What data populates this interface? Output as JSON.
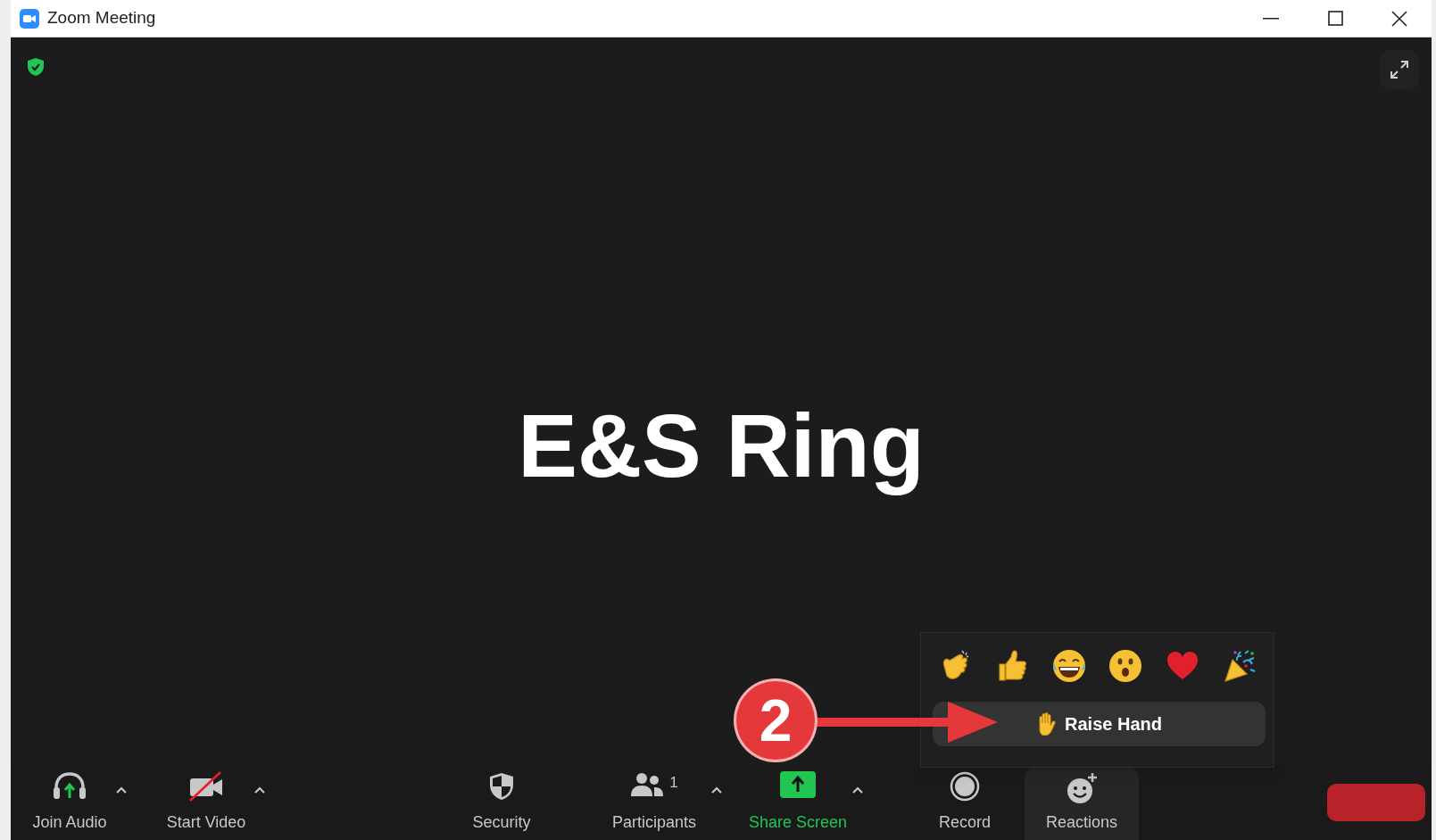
{
  "window": {
    "title": "Zoom Meeting"
  },
  "meeting": {
    "title": "E&S Ring"
  },
  "reactions_popup": {
    "reactions": [
      {
        "kind": "clap"
      },
      {
        "kind": "thumbs"
      },
      {
        "kind": "laugh"
      },
      {
        "kind": "wow"
      },
      {
        "kind": "heart"
      },
      {
        "kind": "party"
      }
    ],
    "raise_hand": {
      "label": "Raise Hand"
    }
  },
  "callout": {
    "number": "2"
  },
  "toolbar": [
    {
      "kind": "audio",
      "label": "Join Audio",
      "caret": true,
      "selected": false
    },
    {
      "kind": "video",
      "label": "Start Video",
      "caret": true,
      "selected": false
    },
    {
      "kind": "security",
      "label": "Security",
      "caret": false,
      "selected": false
    },
    {
      "kind": "participants",
      "label": "Participants",
      "count": "1",
      "caret": true,
      "selected": false
    },
    {
      "kind": "share",
      "label": "Share Screen",
      "caret": true,
      "selected": false
    },
    {
      "kind": "record",
      "label": "Record",
      "caret": false,
      "selected": false
    },
    {
      "kind": "reactions",
      "label": "Reactions",
      "caret": false,
      "selected": true
    },
    {
      "kind": "end"
    }
  ]
}
